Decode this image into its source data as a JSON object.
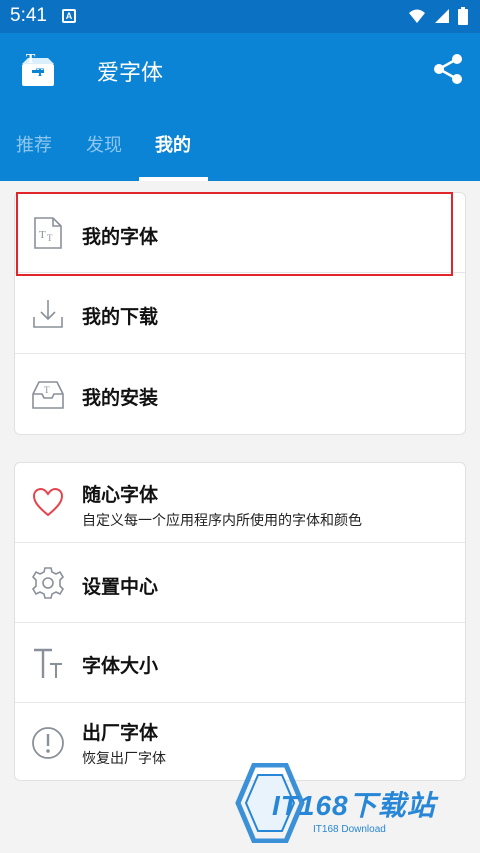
{
  "status_bar": {
    "time": "5:41",
    "notification_icon": "A"
  },
  "app_bar": {
    "title": "爱字体",
    "logo_icon": "font-box-logo",
    "share_icon": "share-icon"
  },
  "tabs": [
    {
      "label": "推荐",
      "active": false
    },
    {
      "label": "发现",
      "active": false
    },
    {
      "label": "我的",
      "active": true
    }
  ],
  "card1": [
    {
      "title": "我的字体",
      "icon": "font-file-icon"
    },
    {
      "title": "我的下载",
      "icon": "download-icon"
    },
    {
      "title": "我的安装",
      "icon": "inbox-icon"
    }
  ],
  "card2": [
    {
      "title": "随心字体",
      "subtitle": "自定义每一个应用程序内所使用的字体和颜色",
      "icon": "heart-icon"
    },
    {
      "title": "设置中心",
      "icon": "gear-icon"
    },
    {
      "title": "字体大小",
      "icon": "text-size-icon"
    },
    {
      "title": "出厂字体",
      "subtitle": "恢复出厂字体",
      "icon": "alert-icon"
    }
  ],
  "watermark": {
    "text": "IT168下载站",
    "sub": "IT168 Download"
  },
  "colors": {
    "primary": "#0b84d6",
    "status_bar": "#0b72c3",
    "highlight": "#e0262b",
    "heart": "#e5444d"
  }
}
